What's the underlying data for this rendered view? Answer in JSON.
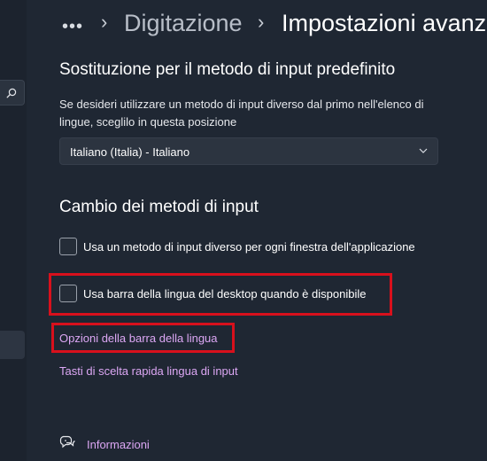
{
  "breadcrumb": {
    "more_icon": "more-horizontal-icon",
    "separator_icon": "chevron-right-icon",
    "parent": "Digitazione",
    "current": "Impostazioni avanz"
  },
  "sidebar": {
    "search_icon": "search-icon"
  },
  "default_input": {
    "title": "Sostituzione per il metodo di input predefinito",
    "description": "Se desideri utilizzare un metodo di input diverso dal primo nell'elenco di lingue, sceglilo in questa posizione",
    "dropdown_value": "Italiano (Italia) - Italiano",
    "dropdown_icon": "chevron-down-icon"
  },
  "switching": {
    "title": "Cambio dei metodi di input",
    "options": [
      {
        "label": "Usa un metodo di input diverso per ogni finestra dell'applicazione",
        "checked": false
      },
      {
        "label": "Usa barra della lingua del desktop quando è disponibile",
        "checked": false
      }
    ],
    "link_language_bar": "Opzioni della barra della lingua",
    "link_hotkeys": "Tasti di scelta rapida lingua di input"
  },
  "footer": {
    "info_icon": "help-chat-icon",
    "info_label": "Informazioni"
  },
  "colors": {
    "background": "#1f2733",
    "link": "#dca7f4",
    "highlight": "#d8101c"
  }
}
